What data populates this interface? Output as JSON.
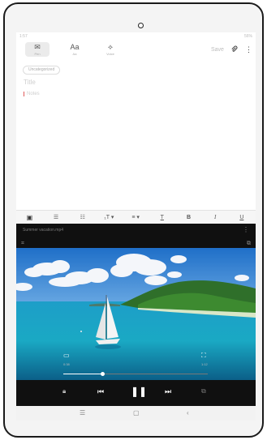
{
  "statusbar": {
    "time": "1:57",
    "right": "56%"
  },
  "notes": {
    "modes": [
      {
        "label": "Pen",
        "icon": "✉"
      },
      {
        "label": "Aa",
        "icon": "Aa"
      },
      {
        "label": "Voice",
        "icon": "⟡"
      }
    ],
    "save_label": "Save",
    "attach_icon": "attach-icon",
    "category": "Uncategorized",
    "title_placeholder": "Title",
    "notes_placeholder": "Notes"
  },
  "format_bar": {
    "items": [
      "▣",
      "☰",
      "☷",
      "₁T ▾",
      "≡ ▾",
      "T",
      "B",
      "I",
      "U"
    ]
  },
  "player": {
    "title": "Summer vacation.mp4",
    "elapsed": "0:38",
    "duration": "1:12",
    "progress": 0.27,
    "colors": {
      "accent": "#ffffff",
      "background": "#101010"
    }
  },
  "navbar": {
    "recent": "recent-apps-icon",
    "home": "home-icon",
    "back": "back-icon"
  }
}
